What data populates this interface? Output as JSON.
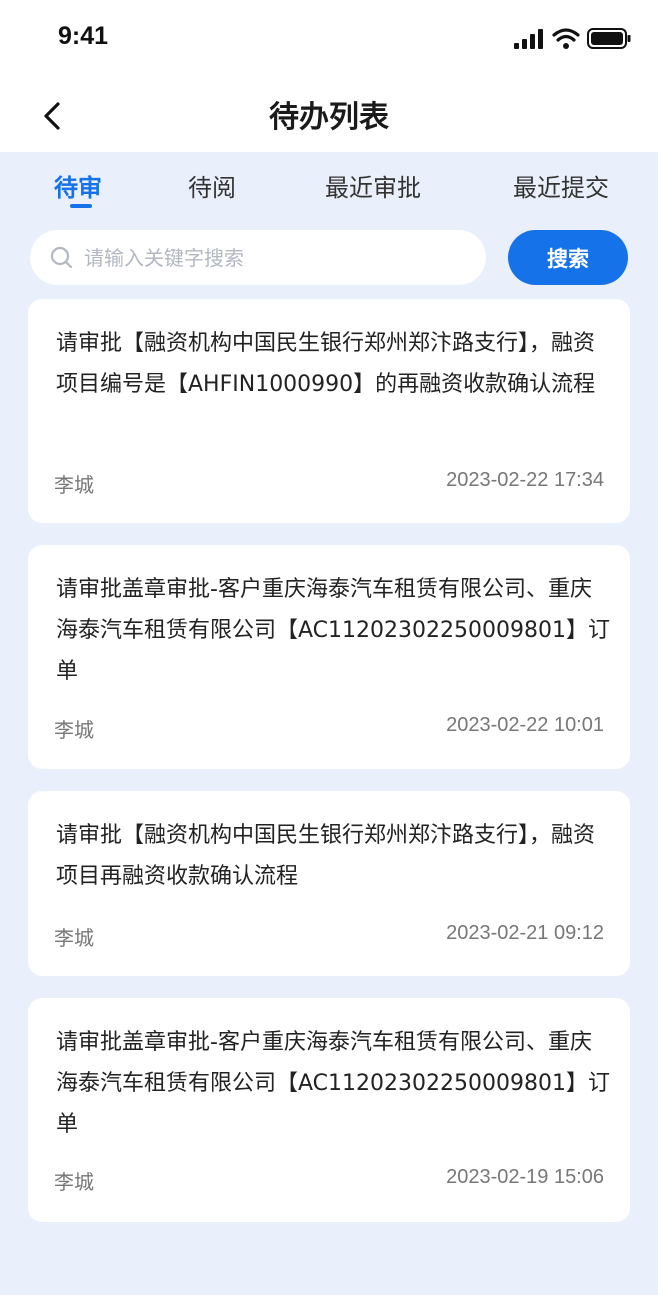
{
  "status_bar": {
    "time": "9:41"
  },
  "header": {
    "title": "待办列表"
  },
  "tabs": [
    {
      "label": "待审",
      "active": true
    },
    {
      "label": "待阅",
      "active": false
    },
    {
      "label": "最近审批",
      "active": false
    },
    {
      "label": "最近提交",
      "active": false
    }
  ],
  "search": {
    "placeholder": "请输入关键字搜索",
    "value": "",
    "button_label": "搜索"
  },
  "colors": {
    "accent": "#1672e8",
    "background": "#e9effb"
  },
  "items": [
    {
      "text": "请审批【融资机构中国民生银行郑州郑汴路支行】，融资项目编号是【AHFIN1000990】的再融资收款确认流程",
      "author": "李城",
      "time": "2023-02-22 17:34"
    },
    {
      "text": "请审批盖章审批-客户重庆海泰汽车租赁有限公司、重庆海泰汽车租赁有限公司【AC11202302250009801】订单",
      "author": "李城",
      "time": "2023-02-22 10:01"
    },
    {
      "text": "请审批【融资机构中国民生银行郑州郑汴路支行】，融资项目再融资收款确认流程",
      "author": "李城",
      "time": "2023-02-21 09:12"
    },
    {
      "text": "请审批盖章审批-客户重庆海泰汽车租赁有限公司、重庆海泰汽车租赁有限公司【AC11202302250009801】订单",
      "author": "李城",
      "time": "2023-02-19 15:06"
    }
  ]
}
